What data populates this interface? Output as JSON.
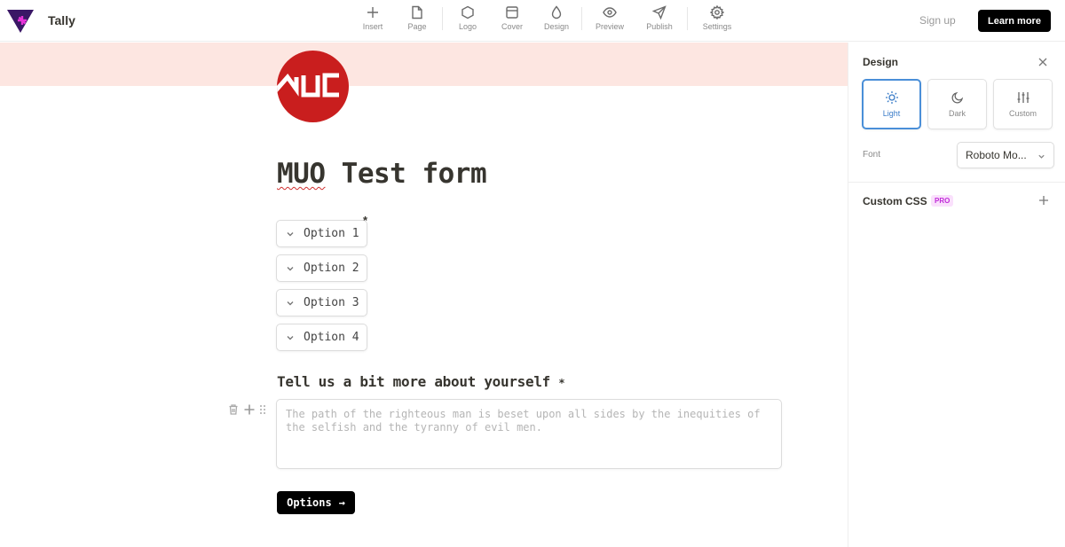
{
  "app": {
    "name": "Tally"
  },
  "toolbar": {
    "items": [
      {
        "label": "Insert",
        "icon": "plus-icon"
      },
      {
        "label": "Page",
        "icon": "page-icon"
      },
      {
        "label": "Logo",
        "icon": "hexagon-icon"
      },
      {
        "label": "Cover",
        "icon": "cover-icon"
      },
      {
        "label": "Design",
        "icon": "droplet-icon"
      },
      {
        "label": "Preview",
        "icon": "eye-icon"
      },
      {
        "label": "Publish",
        "icon": "send-icon"
      },
      {
        "label": "Settings",
        "icon": "gear-icon"
      }
    ],
    "signup_label": "Sign up",
    "learn_more_label": "Learn more"
  },
  "form": {
    "cover_color": "#fde6e1",
    "logo_text": "MUO",
    "title_prefix": "MUO",
    "title_rest": " Test form",
    "options": [
      {
        "label": "Option 1"
      },
      {
        "label": "Option 2"
      },
      {
        "label": "Option 3"
      },
      {
        "label": "Option 4"
      }
    ],
    "required_mark": "*",
    "question_label": "Tell us a bit more about yourself",
    "textarea_placeholder": "The path of the righteous man is beset upon all sides by the inequities of the selfish and the tyranny of evil men.",
    "submit_label": "Options",
    "submit_arrow": "→"
  },
  "design_panel": {
    "title": "Design",
    "themes": [
      {
        "label": "Light",
        "icon": "sun-icon",
        "active": true
      },
      {
        "label": "Dark",
        "icon": "moon-icon",
        "active": false
      },
      {
        "label": "Custom",
        "icon": "sliders-icon",
        "active": false
      }
    ],
    "font_label": "Font",
    "font_value": "Roboto Mo...",
    "custom_css_label": "Custom CSS",
    "pro_badge": "PRO",
    "accent_color": "#4a8fd8"
  }
}
